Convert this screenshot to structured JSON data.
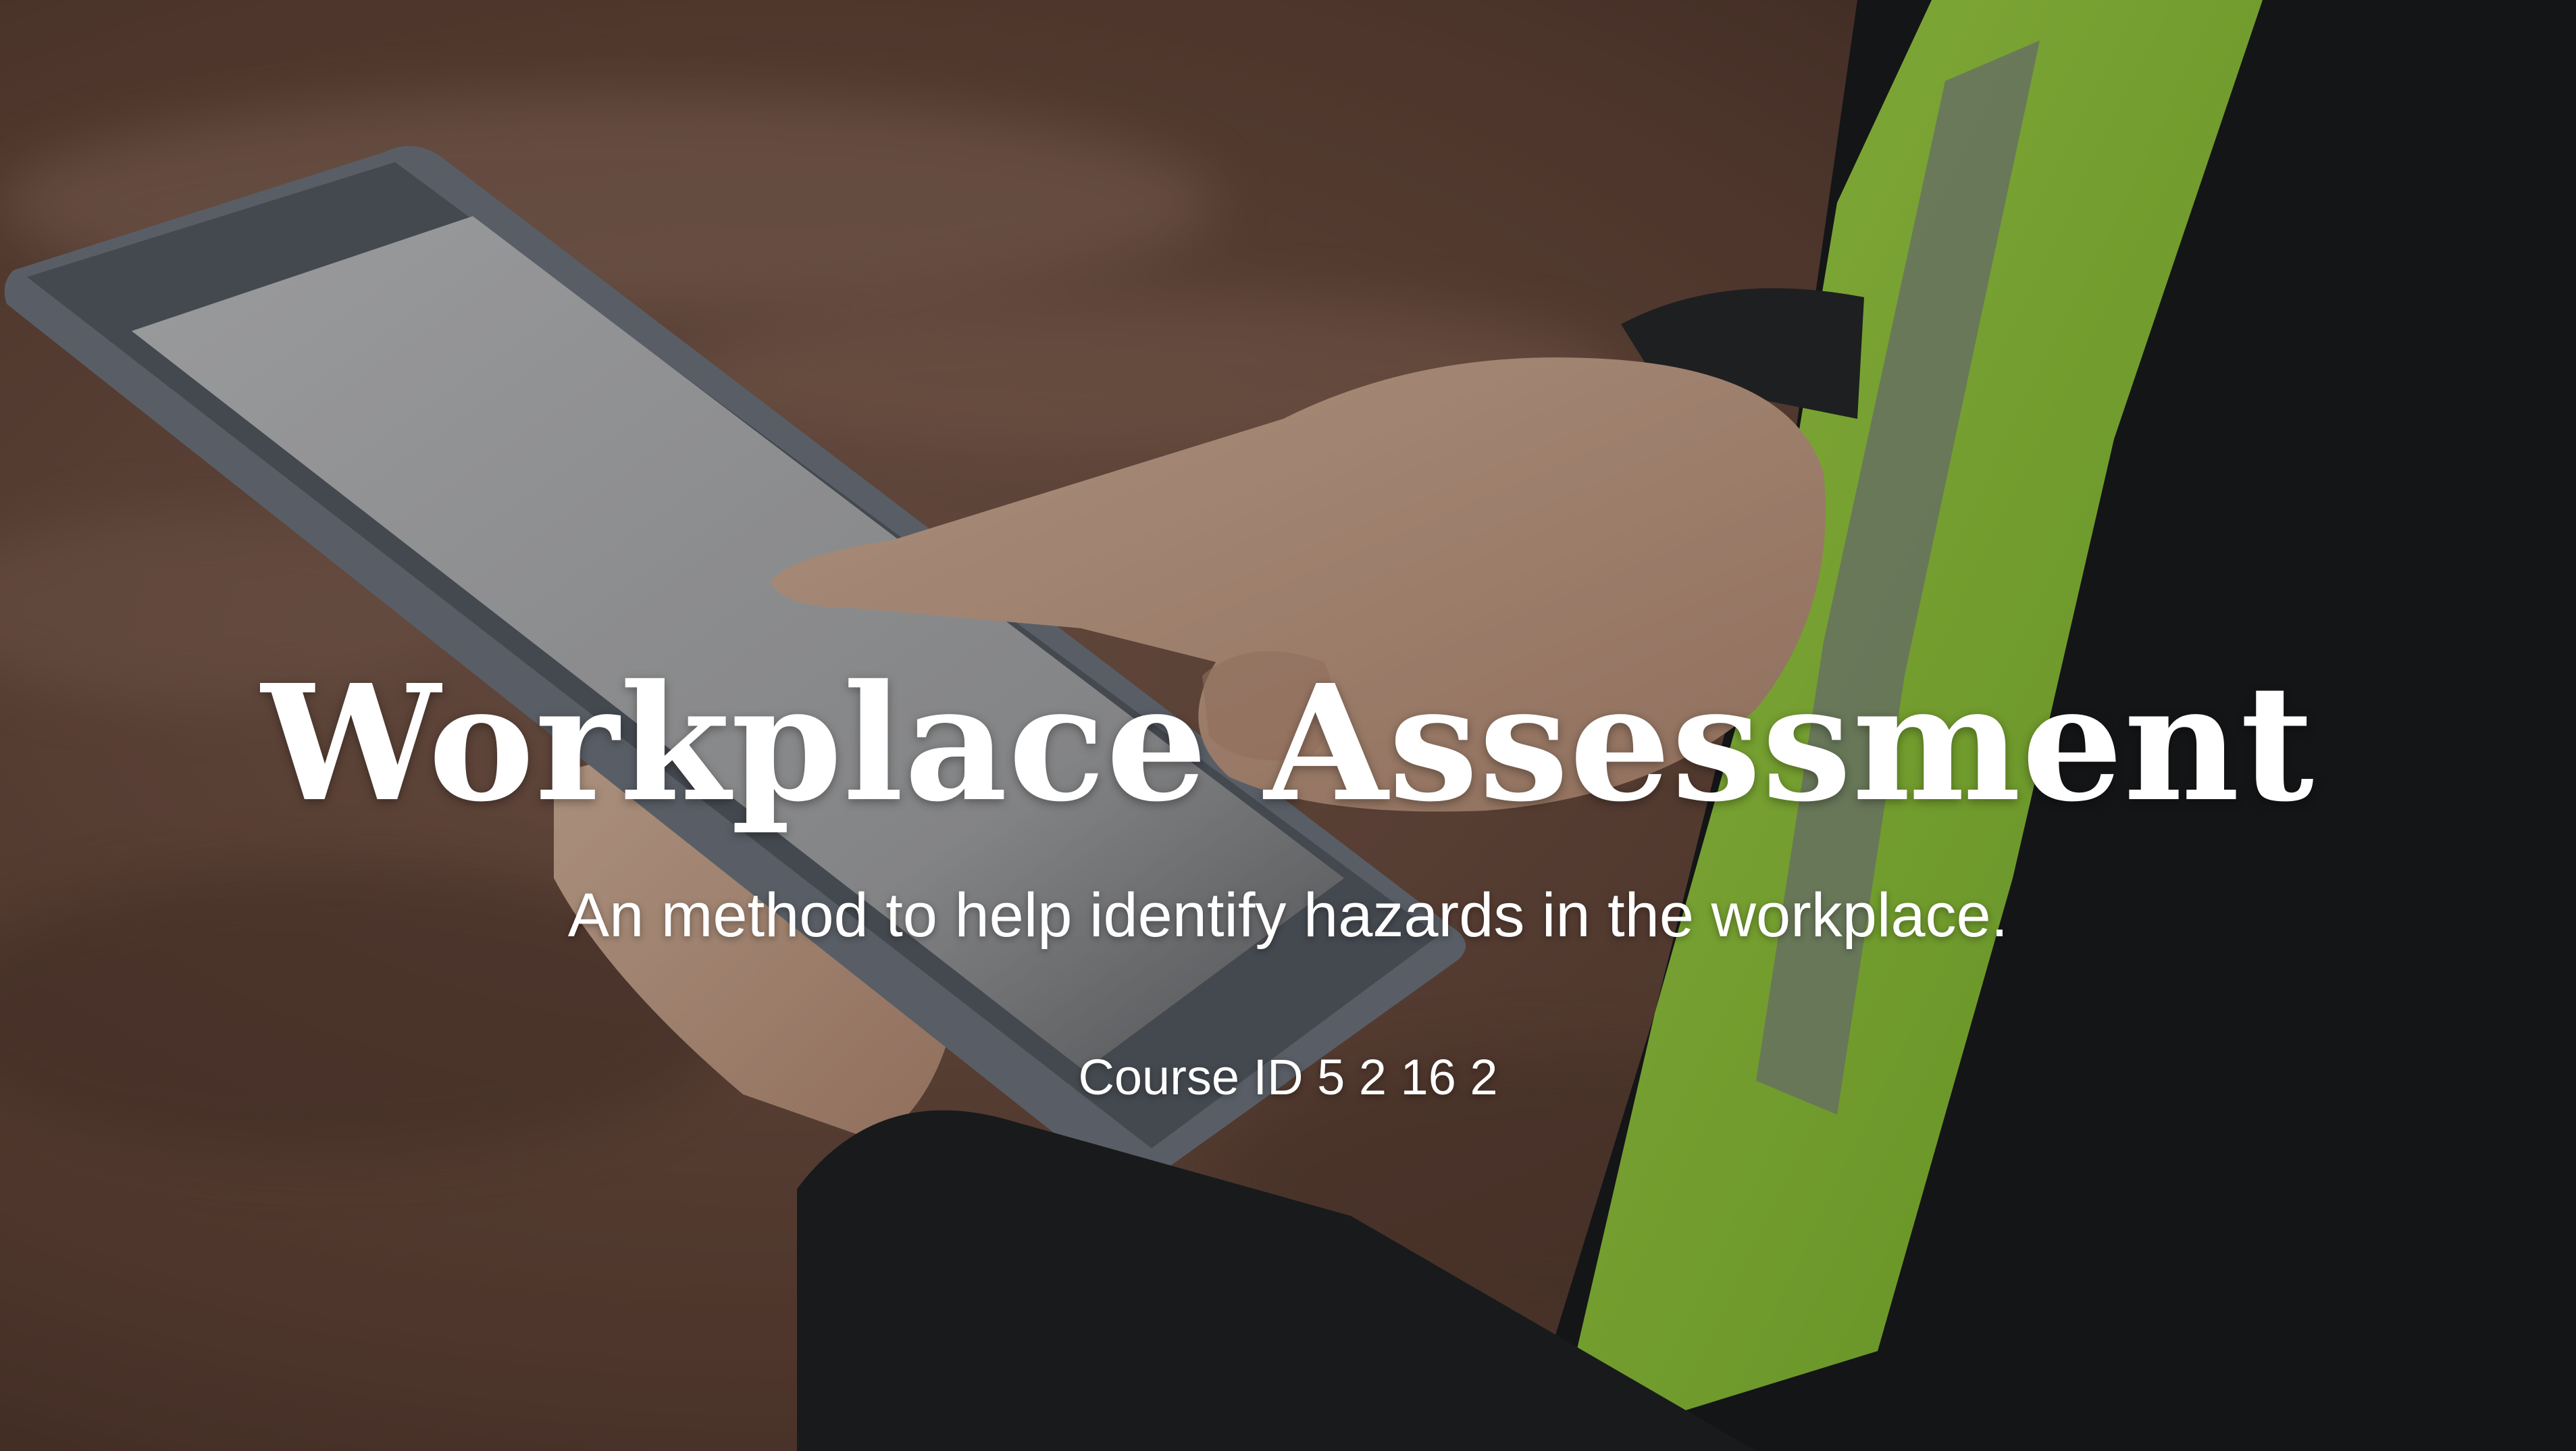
{
  "slide": {
    "title": "Workplace Assessment",
    "subtitle": "An method to help identify hazards in the workplace.",
    "course_id": "Course ID 5 2 16 2"
  },
  "background": {
    "description_icon": "tablet-in-hands-photo",
    "colors": {
      "ground": "#6b4a3c",
      "vest": "#a4e040",
      "sleeve": "#1d1f20",
      "skin": "#d9b49a",
      "tablet_frame": "#7e8590",
      "tablet_screen": "#c9cacc"
    }
  }
}
